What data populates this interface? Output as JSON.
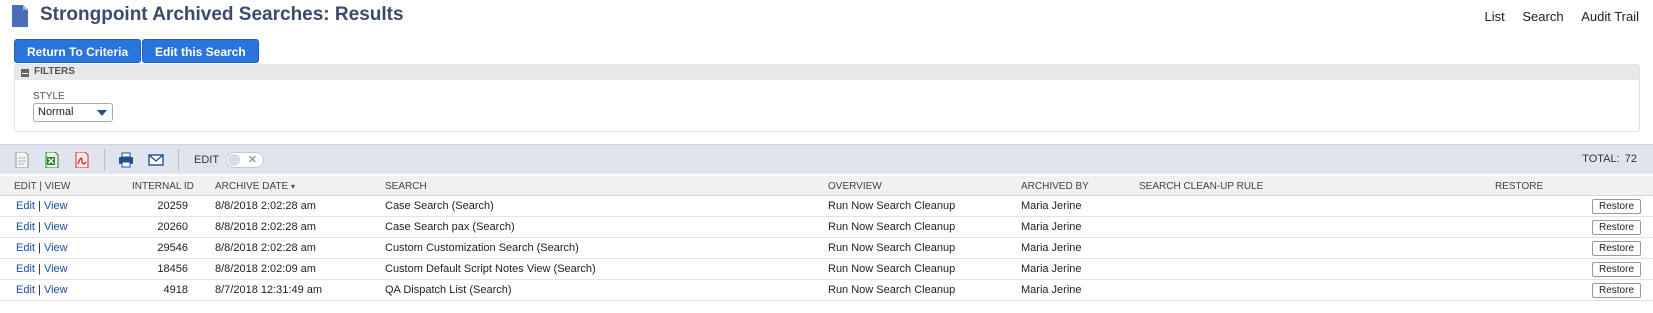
{
  "header": {
    "title": "Strongpoint Archived Searches: Results",
    "links": [
      "List",
      "Search",
      "Audit Trail"
    ]
  },
  "buttons": {
    "return_to_criteria": "Return To Criteria",
    "edit_this_search": "Edit this Search"
  },
  "filters": {
    "label": "FILTERS",
    "style_label": "STYLE",
    "style_value": "Normal"
  },
  "toolbar": {
    "edit_label": "EDIT",
    "total_label": "TOTAL:",
    "total_value": "72"
  },
  "table": {
    "headers": {
      "edit_view": "EDIT | VIEW",
      "internal_id": "INTERNAL ID",
      "archive_date": "ARCHIVE DATE",
      "sort_marker": "▾",
      "search": "SEARCH",
      "overview": "OVERVIEW",
      "archived_by": "ARCHIVED BY",
      "cleanup_rule": "SEARCH CLEAN-UP RULE",
      "restore": "RESTORE"
    },
    "edit_text": "Edit",
    "view_text": "View",
    "separator": "|",
    "restore_button": "Restore",
    "rows": [
      {
        "internal_id": "20259",
        "archive_date": "8/8/2018 2:02:28 am",
        "search": "Case Search (Search)",
        "overview": "Run Now Search Cleanup",
        "archived_by": "Maria Jerine",
        "cleanup_rule": ""
      },
      {
        "internal_id": "20260",
        "archive_date": "8/8/2018 2:02:28 am",
        "search": "Case Search pax (Search)",
        "overview": "Run Now Search Cleanup",
        "archived_by": "Maria Jerine",
        "cleanup_rule": ""
      },
      {
        "internal_id": "29546",
        "archive_date": "8/8/2018 2:02:28 am",
        "search": "Custom Customization Search (Search)",
        "overview": "Run Now Search Cleanup",
        "archived_by": "Maria Jerine",
        "cleanup_rule": ""
      },
      {
        "internal_id": "18456",
        "archive_date": "8/8/2018 2:02:09 am",
        "search": "Custom Default Script Notes View (Search)",
        "overview": "Run Now Search Cleanup",
        "archived_by": "Maria Jerine",
        "cleanup_rule": ""
      },
      {
        "internal_id": "4918",
        "archive_date": "8/7/2018 12:31:49 am",
        "search": "QA Dispatch List (Search)",
        "overview": "Run Now Search Cleanup",
        "archived_by": "Maria Jerine",
        "cleanup_rule": ""
      }
    ]
  },
  "colors": {
    "title": "#3c4a6b",
    "button": "#2a75dd",
    "link": "#1a4e9c",
    "toolbar_bg": "#dfe4ee"
  },
  "icons": [
    "document-icon",
    "export-csv-icon",
    "export-excel-icon",
    "export-pdf-icon",
    "print-icon",
    "email-icon",
    "collapse-icon",
    "dropdown-chevron-icon",
    "toggle-off-icon"
  ]
}
